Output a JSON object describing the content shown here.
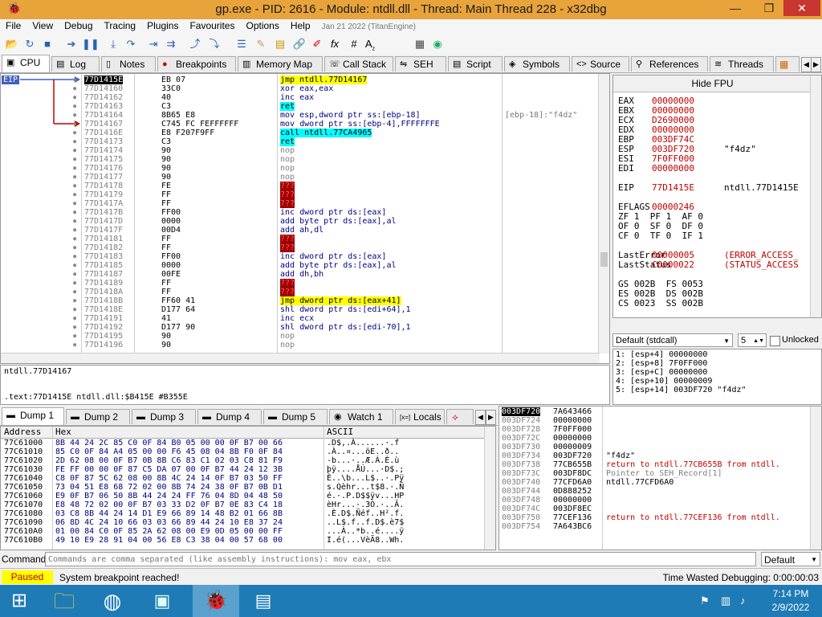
{
  "window": {
    "title": "gp.exe - PID: 2616 - Module: ntdll.dll - Thread: Main Thread 228 - x32dbg"
  },
  "menu": [
    "File",
    "View",
    "Debug",
    "Tracing",
    "Plugins",
    "Favourites",
    "Options",
    "Help"
  ],
  "menu_date": "Jan 21 2022 (TitanEngine)",
  "tabs_top": [
    "CPU",
    "Log",
    "Notes",
    "Breakpoints",
    "Memory Map",
    "Call Stack",
    "SEH",
    "Script",
    "Symbols",
    "Source",
    "References",
    "Threads"
  ],
  "eip_label": "EIP",
  "disasm": [
    {
      "addr": "77D1415E",
      "bytes": "EB 07",
      "instr": "jmp ntdll.77D14167",
      "cmt": ""
    },
    {
      "addr": "77D14160",
      "bytes": "33C0",
      "instr": "xor eax,eax",
      "cmt": ""
    },
    {
      "addr": "77D14162",
      "bytes": "40",
      "instr": "inc eax",
      "cmt": ""
    },
    {
      "addr": "77D14163",
      "bytes": "C3",
      "instr": "ret",
      "cmt": ""
    },
    {
      "addr": "77D14164",
      "bytes": "8B65 E8",
      "instr": "mov esp,dword ptr ss:[ebp-18]",
      "cmt": "[ebp-18]:\"f4dz\""
    },
    {
      "addr": "77D14167",
      "bytes": "C745 FC FEFFFFFF",
      "instr": "mov dword ptr ss:[ebp-4],FFFFFFFE",
      "cmt": ""
    },
    {
      "addr": "77D1416E",
      "bytes": "E8 F207F9FF",
      "instr": "call ntdll.77CA4965",
      "cmt": ""
    },
    {
      "addr": "77D14173",
      "bytes": "C3",
      "instr": "ret",
      "cmt": ""
    },
    {
      "addr": "77D14174",
      "bytes": "90",
      "instr": "nop",
      "cmt": ""
    },
    {
      "addr": "77D14175",
      "bytes": "90",
      "instr": "nop",
      "cmt": ""
    },
    {
      "addr": "77D14176",
      "bytes": "90",
      "instr": "nop",
      "cmt": ""
    },
    {
      "addr": "77D14177",
      "bytes": "90",
      "instr": "nop",
      "cmt": ""
    },
    {
      "addr": "77D14178",
      "bytes": "FE",
      "instr": "???",
      "cmt": ""
    },
    {
      "addr": "77D14179",
      "bytes": "FF",
      "instr": "???",
      "cmt": ""
    },
    {
      "addr": "77D1417A",
      "bytes": "FF",
      "instr": "???",
      "cmt": ""
    },
    {
      "addr": "77D1417B",
      "bytes": "FF00",
      "instr": "inc dword ptr ds:[eax]",
      "cmt": ""
    },
    {
      "addr": "77D1417D",
      "bytes": "0000",
      "instr": "add byte ptr ds:[eax],al",
      "cmt": ""
    },
    {
      "addr": "77D1417F",
      "bytes": "00D4",
      "instr": "add ah,dl",
      "cmt": ""
    },
    {
      "addr": "77D14181",
      "bytes": "FF",
      "instr": "???",
      "cmt": ""
    },
    {
      "addr": "77D14182",
      "bytes": "FF",
      "instr": "???",
      "cmt": ""
    },
    {
      "addr": "77D14183",
      "bytes": "FF00",
      "instr": "inc dword ptr ds:[eax]",
      "cmt": ""
    },
    {
      "addr": "77D14185",
      "bytes": "0000",
      "instr": "add byte ptr ds:[eax],al",
      "cmt": ""
    },
    {
      "addr": "77D14187",
      "bytes": "00FE",
      "instr": "add dh,bh",
      "cmt": ""
    },
    {
      "addr": "77D14189",
      "bytes": "FF",
      "instr": "???",
      "cmt": ""
    },
    {
      "addr": "77D1418A",
      "bytes": "FF",
      "instr": "???",
      "cmt": ""
    },
    {
      "addr": "77D1418B",
      "bytes": "FF60 41",
      "instr": "jmp dword ptr ds:[eax+41]",
      "cmt": ""
    },
    {
      "addr": "77D1418E",
      "bytes": "D177 64",
      "instr": "shl dword ptr ds:[edi+64],1",
      "cmt": ""
    },
    {
      "addr": "77D14191",
      "bytes": "41",
      "instr": "inc ecx",
      "cmt": ""
    },
    {
      "addr": "77D14192",
      "bytes": "D177 90",
      "instr": "shl dword ptr ds:[edi-70],1",
      "cmt": ""
    },
    {
      "addr": "77D14195",
      "bytes": "90",
      "instr": "nop",
      "cmt": ""
    },
    {
      "addr": "77D14196",
      "bytes": "90",
      "instr": "nop",
      "cmt": ""
    }
  ],
  "info_line1": "ntdll.77D14167",
  "info_line2": ".text:77D1415E ntdll.dll:$B415E #B355E",
  "regs_title": "Hide FPU",
  "registers": [
    {
      "n": "EAX",
      "v": "00000000",
      "c": ""
    },
    {
      "n": "EBX",
      "v": "00000000",
      "c": ""
    },
    {
      "n": "ECX",
      "v": "D2690000",
      "c": ""
    },
    {
      "n": "EDX",
      "v": "00000000",
      "c": ""
    },
    {
      "n": "EBP",
      "v": "003DF74C",
      "c": ""
    },
    {
      "n": "ESP",
      "v": "003DF720",
      "c": "\"f4dz\""
    },
    {
      "n": "ESI",
      "v": "7F0FF000",
      "c": ""
    },
    {
      "n": "EDI",
      "v": "00000000",
      "c": ""
    }
  ],
  "eip_reg": {
    "n": "EIP",
    "v": "77D1415E",
    "c": "ntdll.77D1415E"
  },
  "eflags": {
    "n": "EFLAGS",
    "v": "00000246"
  },
  "flags": [
    "ZF 1  PF 1  AF 0",
    "OF 0  SF 0  DF 0",
    "CF 0  TF 0  IF 1"
  ],
  "lasterror": {
    "n": "LastError",
    "v": "00000005",
    "c": "(ERROR_ACCESS_"
  },
  "laststatus": {
    "n": "LastStatus",
    "v": "C0000022",
    "c": "(STATUS_ACCESS"
  },
  "segs": [
    "GS 002B  FS 0053",
    "ES 002B  DS 002B",
    "CS 0023  SS 002B"
  ],
  "callconv": "Default (stdcall)",
  "argcount": "5",
  "unlocked": "Unlocked",
  "args": [
    "1: [esp+4] 00000000",
    "2: [esp+8] 7F0FF000",
    "3: [esp+C] 00000000",
    "4: [esp+10] 00000009",
    "5: [esp+14] 003DF720 \"f4dz\""
  ],
  "tabs_dump": [
    "Dump 1",
    "Dump 2",
    "Dump 3",
    "Dump 4",
    "Dump 5",
    "Watch 1",
    "Locals"
  ],
  "dump_headers": {
    "addr": "Address",
    "hex": "Hex",
    "ascii": "ASCII"
  },
  "dump": [
    {
      "a": "77C61000",
      "h": "8B 44 24 2C 85 C0 0F 84 B0 05 00 00 0F B7 00 66",
      "s": ".D$,.À......·.f"
    },
    {
      "a": "77C61010",
      "h": "85 C0 0F 84 A4 05 00 00 F6 45 08 04 8B F0 0F 84",
      "s": ".À..¤...öE..ð.."
    },
    {
      "a": "77C61020",
      "h": "2D 62 08 00 0F B7 0B 8B C6 83 C1 02 03 C8 81 F9",
      "s": "-b...·..Æ.Á.È.ù"
    },
    {
      "a": "77C61030",
      "h": "FE FF 00 00 0F 87 C5 DA 07 00 0F B7 44 24 12 3B",
      "s": "þÿ....ÅÚ...·D$.;"
    },
    {
      "a": "77C61040",
      "h": "C8 0F 87 5C 62 08 00 8B 4C 24 14 0F B7 03 50 FF",
      "s": "È..\\b...L$..·.Pÿ"
    },
    {
      "a": "77C61050",
      "h": "73 04 51 E8 68 72 02 00 8B 74 24 38 0F B7 0B D1",
      "s": "s.Qèhr...t$8.·.Ñ"
    },
    {
      "a": "77C61060",
      "h": "E9 0F B7 06 50 8B 44 24 24 FF 76 04 8D 04 48 50",
      "s": "é.·.P.D$$ÿv...HP"
    },
    {
      "a": "77C61070",
      "h": "E8 48 72 02 00 0F B7 03 33 D2 0F B7 0E 83 C4 18",
      "s": "èHr...·.3Ò.·..Ä."
    },
    {
      "a": "77C61080",
      "h": "03 C8 8B 44 24 14 D1 E9 66 89 14 48 B2 01 66 8B",
      "s": ".È.D$.Ñéf..H².f."
    },
    {
      "a": "77C61090",
      "h": "06 8D 4C 24 10 66 03 03 66 89 44 24 10 E8 37 24",
      "s": "..L$.f..f.D$.è7$"
    },
    {
      "a": "77C610A0",
      "h": "01 00 84 C0 0F 85 2A 62 08 00 E9 0D 05 00 00 FF",
      "s": "...À..*b..é....ÿ"
    },
    {
      "a": "77C610B0",
      "h": "49 10 E9 28 91 04 00 56 E8 C3 38 04 00 57 68 00",
      "s": "I.é(...VèÃ8..Wh."
    }
  ],
  "stack": [
    {
      "a": "003DF720",
      "v": "7A643466",
      "c": ""
    },
    {
      "a": "003DF724",
      "v": "00000000",
      "c": ""
    },
    {
      "a": "003DF728",
      "v": "7F0FF000",
      "c": ""
    },
    {
      "a": "003DF72C",
      "v": "00000000",
      "c": ""
    },
    {
      "a": "003DF730",
      "v": "00000009",
      "c": ""
    },
    {
      "a": "003DF734",
      "v": "003DF720",
      "c": "\"f4dz\""
    },
    {
      "a": "003DF738",
      "v": "77CB655B",
      "c": "return to ntdll.77CB655B from ntdll."
    },
    {
      "a": "003DF73C",
      "v": "003DF8DC",
      "c": "Pointer to SEH_Record[1]"
    },
    {
      "a": "003DF740",
      "v": "77CFD6A0",
      "c": "ntdll.77CFD6A0"
    },
    {
      "a": "003DF744",
      "v": "0D888252",
      "c": ""
    },
    {
      "a": "003DF748",
      "v": "00000000",
      "c": ""
    },
    {
      "a": "003DF74C",
      "v": "003DF8EC",
      "c": ""
    },
    {
      "a": "003DF750",
      "v": "77CEF136",
      "c": "return to ntdll.77CEF136 from ntdll."
    },
    {
      "a": "003DF754",
      "v": "7A643BC6",
      "c": ""
    }
  ],
  "command": {
    "label": "Command:",
    "placeholder": "Commands are comma separated (like assembly instructions): mov eax, ebx",
    "mode": "Default"
  },
  "status": {
    "state": "Paused",
    "message": "System breakpoint reached!",
    "time": "Time Wasted Debugging: 0:00:00:03"
  },
  "clock": {
    "time": "7:14 PM",
    "date": "2/9/2022"
  },
  "colors": {
    "title_bar": "#e8a33b",
    "paused": "#ffff00",
    "taskbar": "#1e7bb5"
  }
}
